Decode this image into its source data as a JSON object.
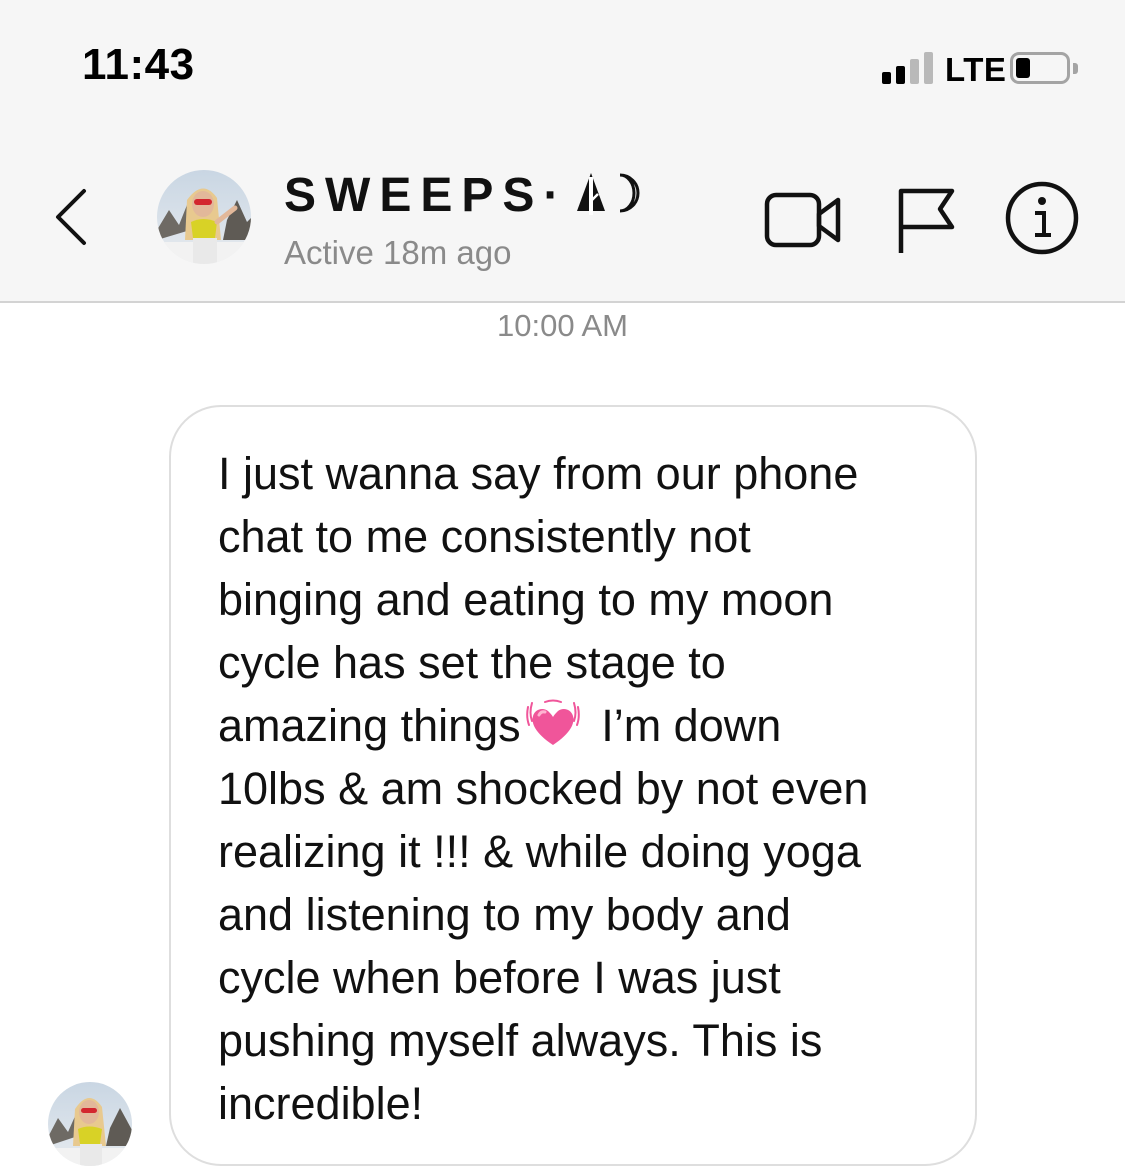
{
  "status_bar": {
    "time": "11:43",
    "network": "LTE",
    "signal_bars_filled": 2,
    "signal_bars_total": 4
  },
  "header": {
    "contact_name": "SWEEPS·",
    "contact_status": "Active 18m ago",
    "icons": [
      "chevron-left-icon",
      "video-camera-icon",
      "flag-icon",
      "info-icon",
      "tree-icon",
      "moon-icon"
    ]
  },
  "conversation": {
    "timestamp": "10:00 AM",
    "message": {
      "part1": "I just wanna say from our phone\nchat to me consistently not\nbinging and eating to my moon\ncycle has set the stage to\namazing things",
      "emoji": "growing-heart-icon",
      "part2": " I’m down\n10lbs & am shocked by not even\nrealizing it !!! & while doing yoga\nand listening to my body and\ncycle when before I was just\npushing myself always. This is\nincredible!"
    }
  },
  "colors": {
    "header_bg": "#f6f6f6",
    "muted_text": "#8a8a8a",
    "bubble_border": "#dedede",
    "heart": "#f0559a"
  }
}
